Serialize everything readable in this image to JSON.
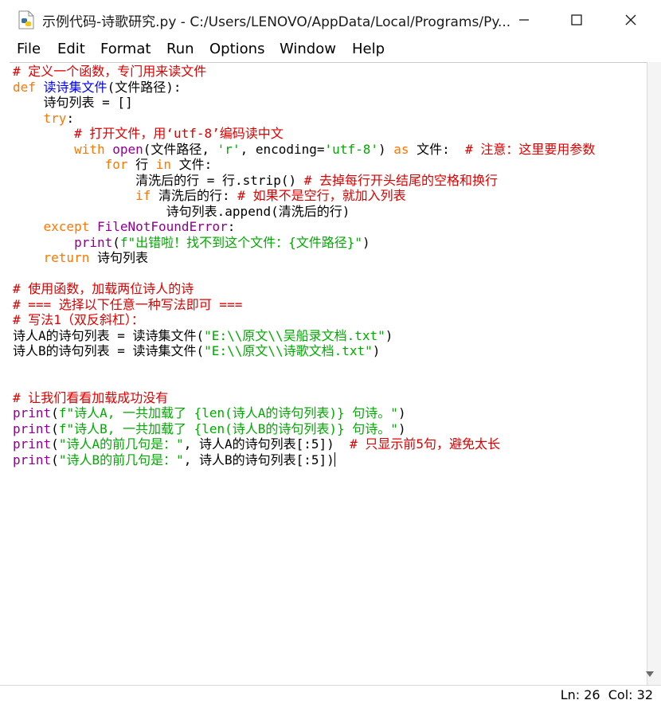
{
  "window": {
    "title": "示例代码-诗歌研究.py - C:/Users/LENOVO/AppData/Local/Programs/Py...",
    "icon": "python-file-icon"
  },
  "menu": [
    "File",
    "Edit",
    "Format",
    "Run",
    "Options",
    "Window",
    "Help"
  ],
  "code": [
    [
      {
        "t": "# 定义一个函数，专门用来读文件",
        "c": "comment"
      }
    ],
    [
      {
        "t": "def",
        "c": "keyword"
      },
      {
        "t": " "
      },
      {
        "t": "读诗集文件",
        "c": "def"
      },
      {
        "t": "(文件路径):"
      }
    ],
    [
      {
        "t": "    诗句列表 = []"
      }
    ],
    [
      {
        "t": "    "
      },
      {
        "t": "try",
        "c": "keyword"
      },
      {
        "t": ":"
      }
    ],
    [
      {
        "t": "        "
      },
      {
        "t": "# 打开文件，用‘utf-8’编码读中文",
        "c": "comment"
      }
    ],
    [
      {
        "t": "        "
      },
      {
        "t": "with",
        "c": "keyword"
      },
      {
        "t": " "
      },
      {
        "t": "open",
        "c": "builtin"
      },
      {
        "t": "(文件路径, "
      },
      {
        "t": "'r'",
        "c": "string"
      },
      {
        "t": ", encoding="
      },
      {
        "t": "'utf-8'",
        "c": "string"
      },
      {
        "t": ") "
      },
      {
        "t": "as",
        "c": "keyword"
      },
      {
        "t": " 文件:  "
      },
      {
        "t": "# 注意：这里要用参数",
        "c": "comment"
      }
    ],
    [
      {
        "t": "            "
      },
      {
        "t": "for",
        "c": "keyword"
      },
      {
        "t": " 行 "
      },
      {
        "t": "in",
        "c": "keyword"
      },
      {
        "t": " 文件:"
      }
    ],
    [
      {
        "t": "                清洗后的行 = 行.strip() "
      },
      {
        "t": "# 去掉每行开头结尾的空格和换行",
        "c": "comment"
      }
    ],
    [
      {
        "t": "                "
      },
      {
        "t": "if",
        "c": "keyword"
      },
      {
        "t": " 清洗后的行: "
      },
      {
        "t": "# 如果不是空行，就加入列表",
        "c": "comment"
      }
    ],
    [
      {
        "t": "                    诗句列表.append(清洗后的行)"
      }
    ],
    [
      {
        "t": "    "
      },
      {
        "t": "except",
        "c": "keyword"
      },
      {
        "t": " "
      },
      {
        "t": "FileNotFoundError",
        "c": "builtin"
      },
      {
        "t": ":"
      }
    ],
    [
      {
        "t": "        "
      },
      {
        "t": "print",
        "c": "builtin"
      },
      {
        "t": "("
      },
      {
        "t": "f\"出错啦！找不到这个文件：{文件路径}\"",
        "c": "string"
      },
      {
        "t": ")"
      }
    ],
    [
      {
        "t": "    "
      },
      {
        "t": "return",
        "c": "keyword"
      },
      {
        "t": " 诗句列表"
      }
    ],
    [],
    [
      {
        "t": "# 使用函数，加载两位诗人的诗",
        "c": "comment"
      }
    ],
    [
      {
        "t": "# === 选择以下任意一种写法即可 ===",
        "c": "comment"
      }
    ],
    [
      {
        "t": "# 写法1（双反斜杠）：",
        "c": "comment"
      }
    ],
    [
      {
        "t": "诗人A的诗句列表 = 读诗集文件("
      },
      {
        "t": "\"E:\\\\原文\\\\吴船录文档.txt\"",
        "c": "string"
      },
      {
        "t": ")"
      }
    ],
    [
      {
        "t": "诗人B的诗句列表 = 读诗集文件("
      },
      {
        "t": "\"E:\\\\原文\\\\诗歌文档.txt\"",
        "c": "string"
      },
      {
        "t": ")"
      }
    ],
    [],
    [],
    [
      {
        "t": "# 让我们看看加载成功没有",
        "c": "comment"
      }
    ],
    [
      {
        "t": "print",
        "c": "builtin"
      },
      {
        "t": "("
      },
      {
        "t": "f\"诗人A, 一共加载了 {len(诗人A的诗句列表)} 句诗。\"",
        "c": "string"
      },
      {
        "t": ")"
      }
    ],
    [
      {
        "t": "print",
        "c": "builtin"
      },
      {
        "t": "("
      },
      {
        "t": "f\"诗人B, 一共加载了 {len(诗人B的诗句列表)} 句诗。\"",
        "c": "string"
      },
      {
        "t": ")"
      }
    ],
    [
      {
        "t": "print",
        "c": "builtin"
      },
      {
        "t": "("
      },
      {
        "t": "\"诗人A的前几句是：\"",
        "c": "string"
      },
      {
        "t": ", 诗人A的诗句列表[:5])  "
      },
      {
        "t": "# 只显示前5句，避免太长",
        "c": "comment"
      }
    ],
    [
      {
        "t": "print",
        "c": "builtin"
      },
      {
        "t": "("
      },
      {
        "t": "\"诗人B的前几句是：\"",
        "c": "string"
      },
      {
        "t": ", 诗人B的诗句列表[:5])"
      }
    ]
  ],
  "cursor_line": 25,
  "status": {
    "line": "Ln: 26",
    "col": "Col: 32"
  },
  "colors": {
    "comment": "#dd0000",
    "keyword": "#ff7700",
    "builtin": "#900090",
    "string": "#00aa00",
    "def": "#0000ff"
  }
}
